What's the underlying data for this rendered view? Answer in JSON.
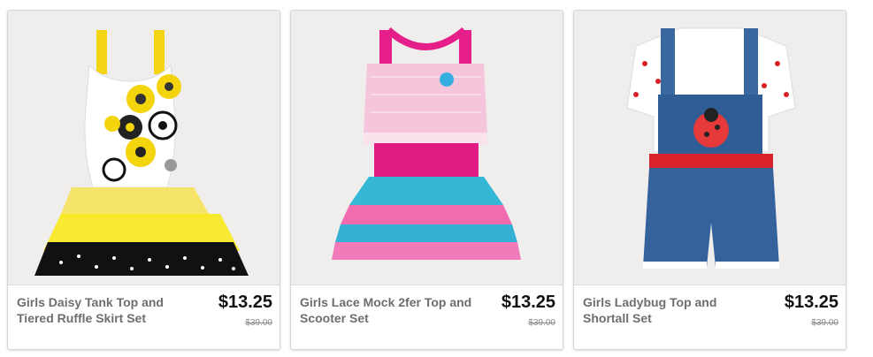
{
  "products": [
    {
      "name": "Girls Daisy Tank Top and Tiered Ruffle Skirt Set",
      "price": "$13.25",
      "original_price": "$39.00",
      "image_icon": "outfit-daisy-image",
      "colors": {
        "primary": "#f5d90a",
        "secondary": "#111111",
        "top": "#ffffff"
      }
    },
    {
      "name": "Girls Lace Mock 2fer Top and Scooter Set",
      "price": "$13.25",
      "original_price": "$39.00",
      "image_icon": "outfit-lace-image",
      "colors": {
        "primary": "#e51e8a",
        "secondary": "#2fb4d6",
        "top": "#f7c6de"
      }
    },
    {
      "name": "Girls Ladybug Top and Shortall Set",
      "price": "$13.25",
      "original_price": "$39.00",
      "image_icon": "outfit-ladybug-image",
      "colors": {
        "primary": "#2f5d95",
        "secondary": "#d9212b",
        "top": "#ffffff"
      }
    }
  ]
}
